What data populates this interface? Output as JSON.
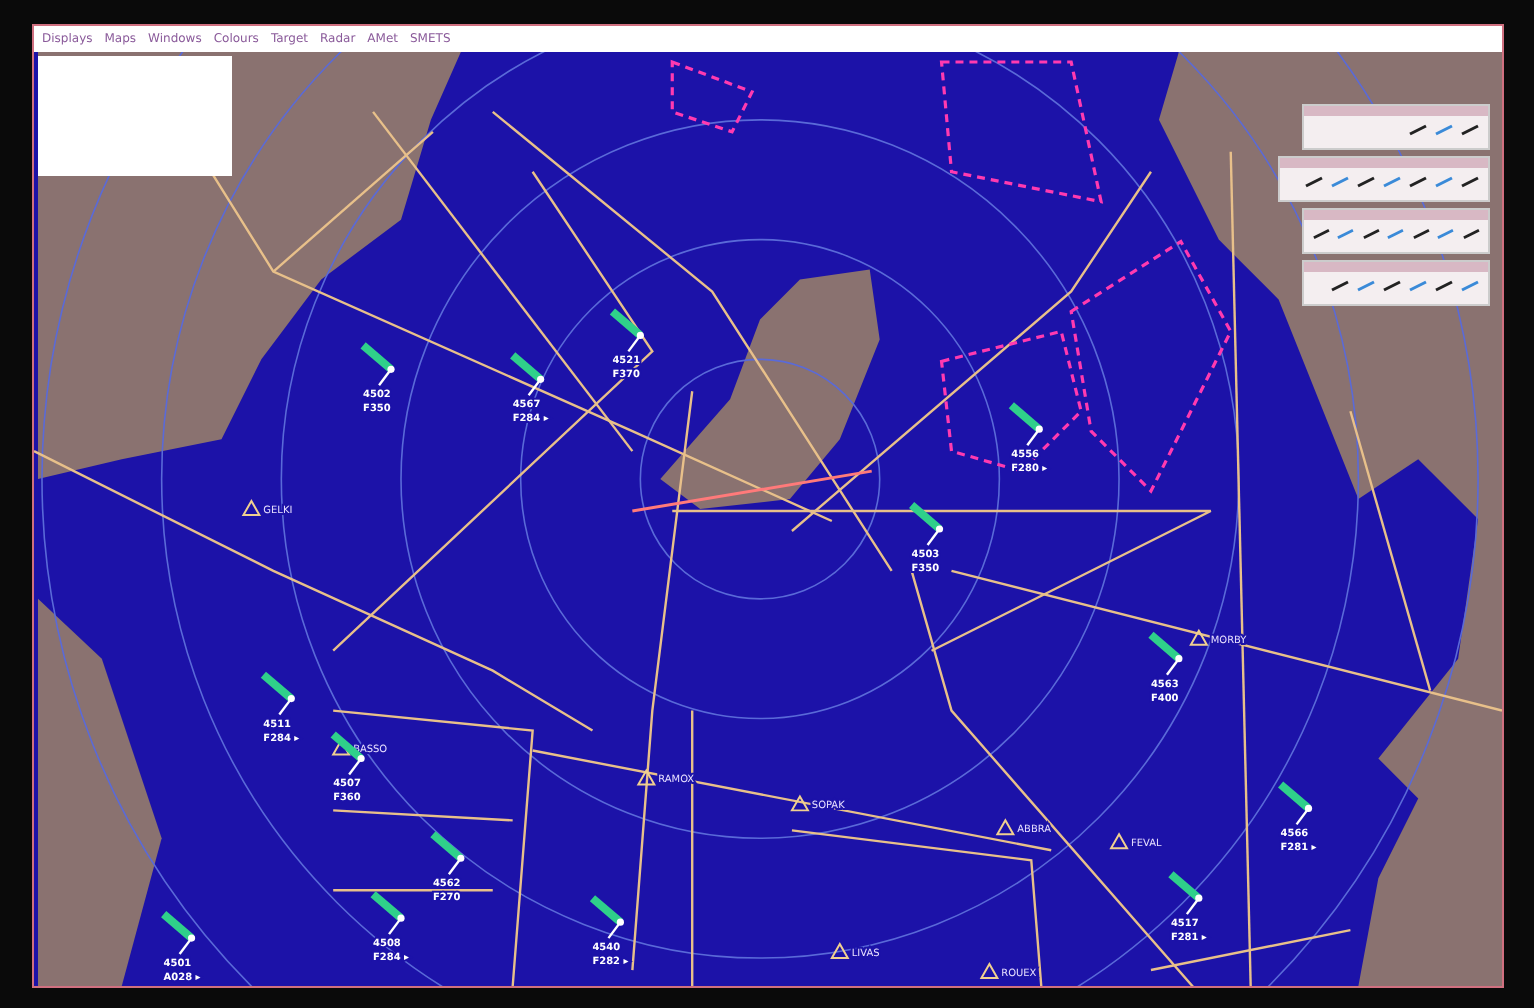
{
  "menu_bar": {
    "items": [
      "Displays",
      "Maps",
      "Windows",
      "Colours",
      "Target",
      "Radar",
      "AMet",
      "SMETS"
    ]
  },
  "map": {
    "waypoints": [
      "GELKI",
      "BASSO",
      "RAMOX",
      "SOPAK",
      "MORBY",
      "ABBRA",
      "FEVAL",
      "LIVAS",
      "ROUEX"
    ],
    "aircraft": [
      {
        "callsign": "4502",
        "level": "F350"
      },
      {
        "callsign": "4567",
        "level": "F284 ▸"
      },
      {
        "callsign": "4521",
        "level": "F370"
      },
      {
        "callsign": "4556",
        "level": "F280 ▸"
      },
      {
        "callsign": "4503",
        "level": "F350"
      },
      {
        "callsign": "4511",
        "level": "F284 ▸"
      },
      {
        "callsign": "4507",
        "level": "F360"
      },
      {
        "callsign": "4562",
        "level": "F270"
      },
      {
        "callsign": "4508",
        "level": "F284 ▸"
      },
      {
        "callsign": "4501",
        "level": "A028 ▸"
      },
      {
        "callsign": "4540",
        "level": "F282 ▸"
      },
      {
        "callsign": "4563",
        "level": "F400"
      },
      {
        "callsign": "4566",
        "level": "F281 ▸"
      },
      {
        "callsign": "4517",
        "level": "F281 ▸"
      }
    ]
  }
}
